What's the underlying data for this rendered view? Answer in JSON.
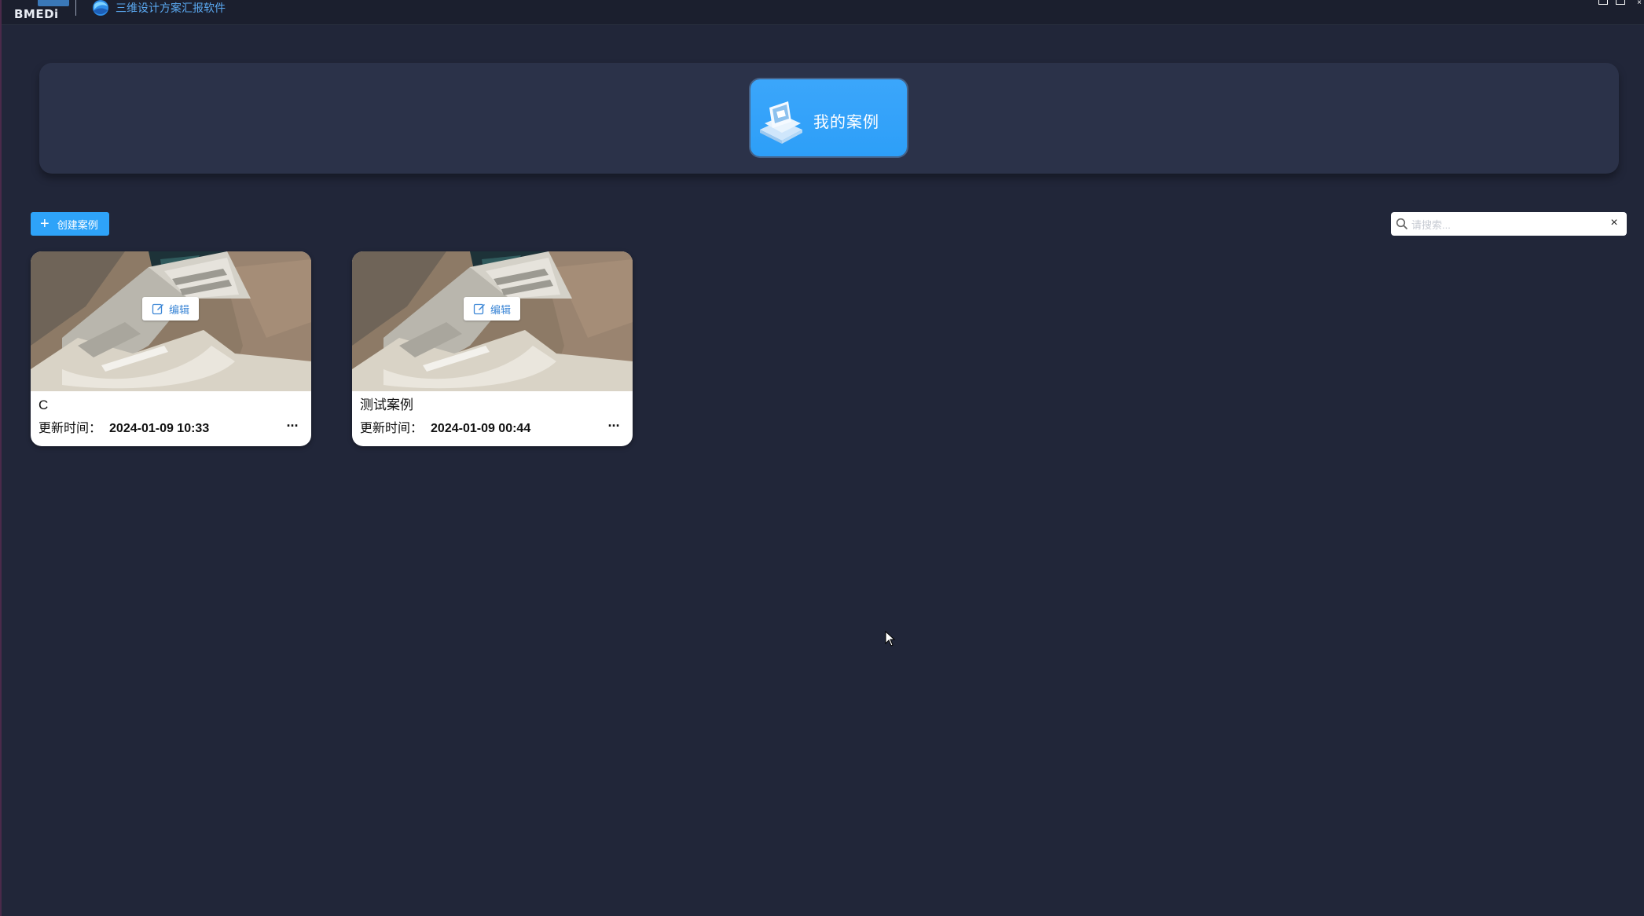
{
  "titlebar": {
    "brand": "BMEDi",
    "app_title": "三维设计方案汇报软件",
    "controls": [
      "minimize",
      "maximize",
      "close"
    ],
    "close_glyph": "×"
  },
  "hero": {
    "label": "我的案例",
    "icon": "stack-icon"
  },
  "toolbar": {
    "create_label": "创建案例",
    "create_glyph": "+",
    "search_placeholder": "请搜索...",
    "search_value": "",
    "clear_glyph": "×"
  },
  "cards": [
    {
      "title": "C",
      "meta_label": "更新时间：",
      "updated": "2024-01-09 10:33",
      "edit_label": "编辑",
      "more_glyph": "···"
    },
    {
      "title": "测试案例",
      "meta_label": "更新时间：",
      "updated": "2024-01-09 00:44",
      "edit_label": "编辑",
      "more_glyph": "···"
    }
  ],
  "colors": {
    "background": "#212639",
    "panel": "#2b3249",
    "accent": "#2ea3f9",
    "title_text": "#5aa8f0"
  }
}
